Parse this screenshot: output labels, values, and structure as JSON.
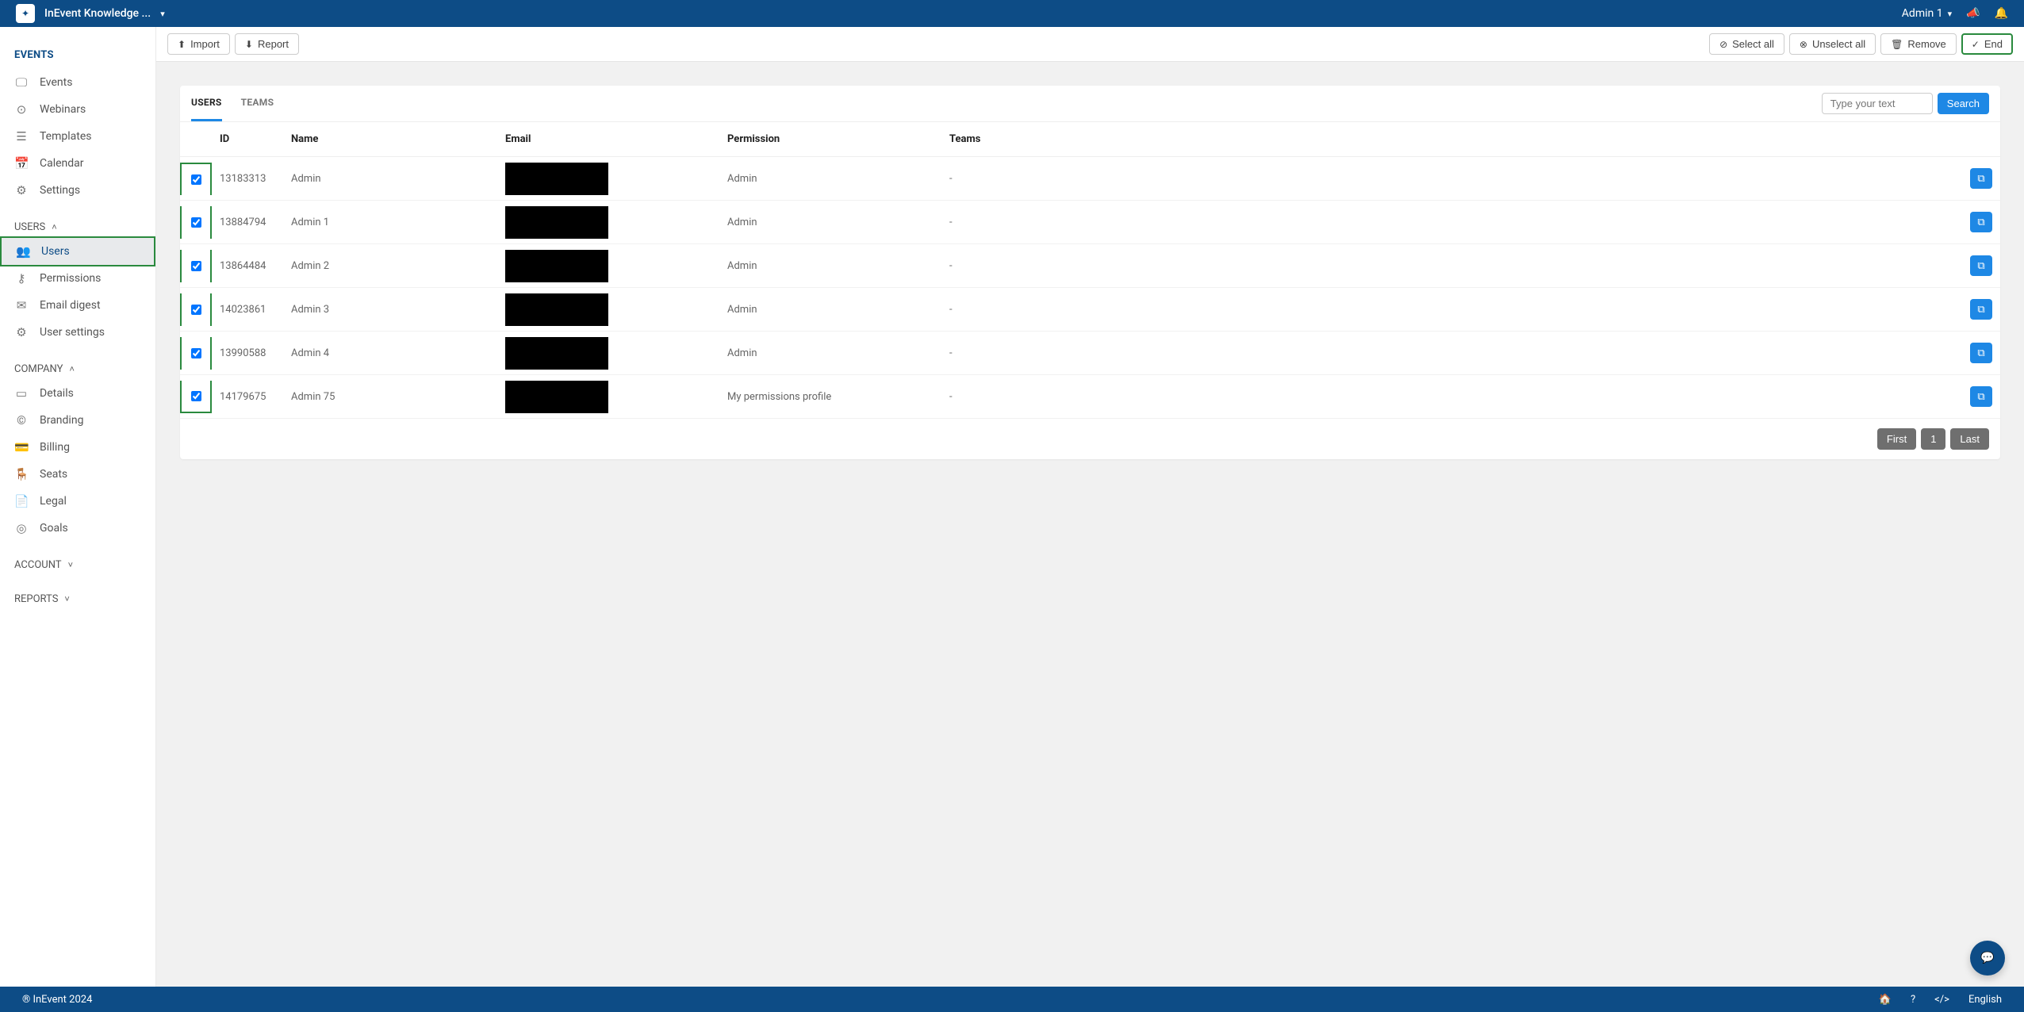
{
  "topbar": {
    "app_title": "InEvent Knowledge ...",
    "user_label": "Admin 1"
  },
  "sidebar": {
    "events_title": "EVENTS",
    "events_items": [
      "Events",
      "Webinars",
      "Templates",
      "Calendar",
      "Settings"
    ],
    "users_title": "USERS",
    "users_items": [
      "Users",
      "Permissions",
      "Email digest",
      "User settings"
    ],
    "company_title": "COMPANY",
    "company_items": [
      "Details",
      "Branding",
      "Billing",
      "Seats",
      "Legal",
      "Goals"
    ],
    "account_title": "ACCOUNT",
    "reports_title": "REPORTS"
  },
  "toolbar": {
    "import": "Import",
    "report": "Report",
    "select_all": "Select all",
    "unselect_all": "Unselect all",
    "remove": "Remove",
    "end": "End"
  },
  "tabs": {
    "users": "USERS",
    "teams": "TEAMS"
  },
  "search": {
    "placeholder": "Type your text",
    "button": "Search"
  },
  "table": {
    "headers": {
      "id": "ID",
      "name": "Name",
      "email": "Email",
      "permission": "Permission",
      "teams": "Teams"
    },
    "rows": [
      {
        "id": "13183313",
        "name": "Admin",
        "permission": "Admin",
        "teams": "-"
      },
      {
        "id": "13884794",
        "name": "Admin 1",
        "permission": "Admin",
        "teams": "-"
      },
      {
        "id": "13864484",
        "name": "Admin 2",
        "permission": "Admin",
        "teams": "-"
      },
      {
        "id": "14023861",
        "name": "Admin 3",
        "permission": "Admin",
        "teams": "-"
      },
      {
        "id": "13990588",
        "name": "Admin 4",
        "permission": "Admin",
        "teams": "-"
      },
      {
        "id": "14179675",
        "name": "Admin 75",
        "permission": "My permissions profile",
        "teams": "-"
      }
    ]
  },
  "pagination": {
    "first": "First",
    "page": "1",
    "last": "Last"
  },
  "footer": {
    "copyright": "® InEvent 2024",
    "lang": "English"
  }
}
